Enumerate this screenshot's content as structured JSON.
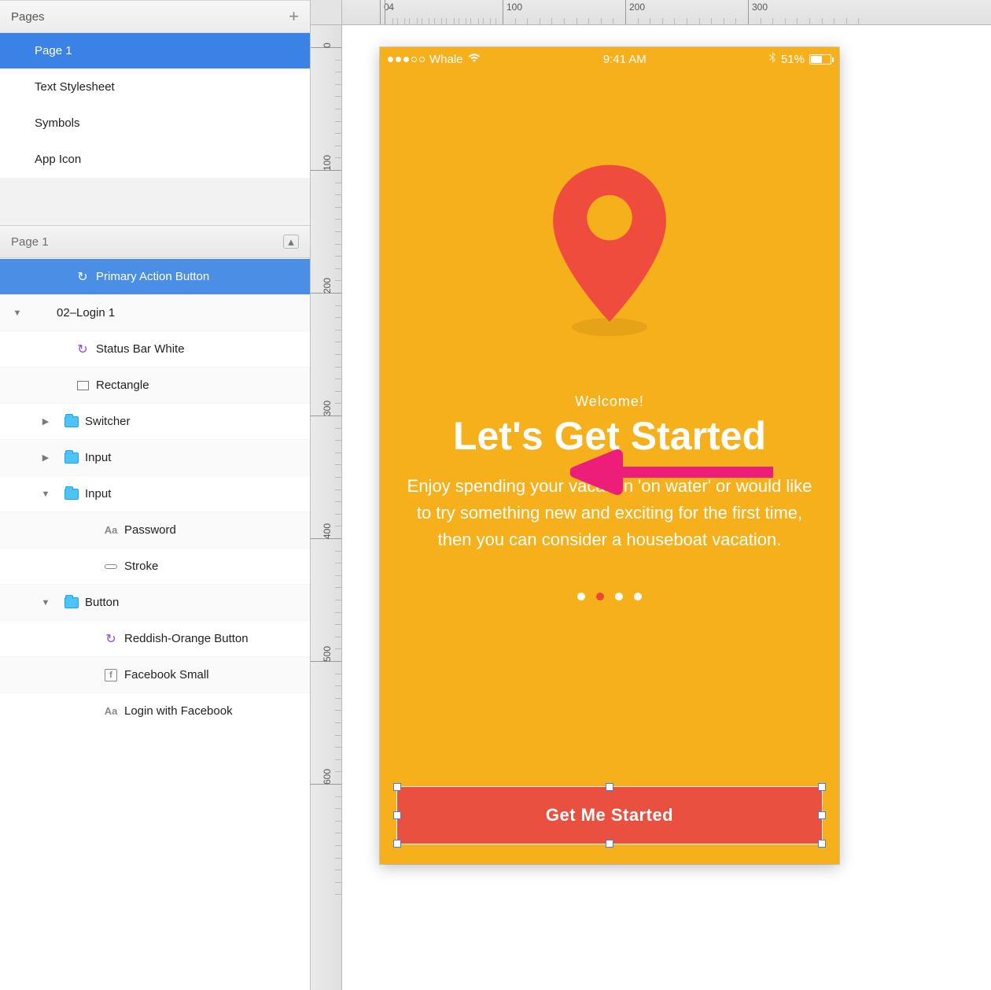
{
  "sidebar": {
    "pages_header": "Pages",
    "pages": [
      {
        "label": "Page 1",
        "selected": true
      },
      {
        "label": "Text Stylesheet",
        "selected": false
      },
      {
        "label": "Symbols",
        "selected": false
      },
      {
        "label": "App Icon",
        "selected": false
      }
    ],
    "layers_header": "Page 1",
    "layers": [
      {
        "label": "Primary Action Button",
        "indent": 1,
        "icon": "symbol",
        "selected": true,
        "disclosure": ""
      },
      {
        "label": "02–Login 1",
        "indent": 0,
        "icon": "",
        "disclosure": "down",
        "alt": true
      },
      {
        "label": "Status Bar White",
        "indent": 1,
        "icon": "symbol-p",
        "disclosure": ""
      },
      {
        "label": "Rectangle",
        "indent": 1,
        "icon": "rect",
        "disclosure": "",
        "alt": true
      },
      {
        "label": "Switcher",
        "indent": 1,
        "icon": "folder",
        "disclosure": "right"
      },
      {
        "label": "Input",
        "indent": 1,
        "icon": "folder",
        "disclosure": "right",
        "alt": true
      },
      {
        "label": "Input",
        "indent": 1,
        "icon": "folder",
        "disclosure": "down"
      },
      {
        "label": "Password",
        "indent": 2,
        "icon": "text",
        "disclosure": "",
        "alt": true
      },
      {
        "label": "Stroke",
        "indent": 2,
        "icon": "line",
        "disclosure": ""
      },
      {
        "label": "Button",
        "indent": 1,
        "icon": "folder",
        "disclosure": "down",
        "alt": true
      },
      {
        "label": "Reddish-Orange Button",
        "indent": 2,
        "icon": "symbol-p",
        "disclosure": ""
      },
      {
        "label": "Facebook Small",
        "indent": 2,
        "icon": "fb",
        "disclosure": "",
        "alt": true
      },
      {
        "label": "Login with Facebook",
        "indent": 2,
        "icon": "text",
        "disclosure": ""
      }
    ]
  },
  "ruler": {
    "h_ticks": [
      "0",
      "100",
      "200",
      "300",
      "4"
    ],
    "v_ticks": [
      "0",
      "100",
      "200",
      "300",
      "400",
      "500",
      "600"
    ]
  },
  "artboard": {
    "status": {
      "carrier": "Whale",
      "time": "9:41 AM",
      "battery_pct": "51%"
    },
    "welcome": "Welcome!",
    "headline": "Let's Get Started",
    "body": "Enjoy spending your vacation 'on water' or would like to try something new and exciting for the first time, then you can consider a houseboat vacation.",
    "cta": "Get Me Started",
    "pager_active_index": 1,
    "pager_count": 4
  }
}
